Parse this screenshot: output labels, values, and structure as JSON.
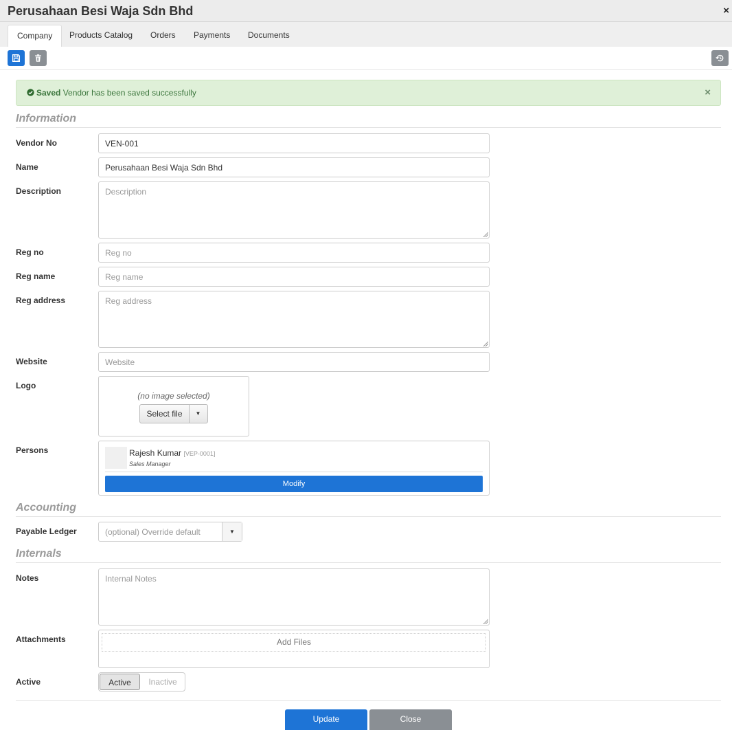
{
  "window": {
    "title": "Perusahaan Besi Waja Sdn Bhd",
    "close_glyph": "×"
  },
  "tabs": [
    {
      "label": "Company",
      "active": true
    },
    {
      "label": "Products Catalog"
    },
    {
      "label": "Orders"
    },
    {
      "label": "Payments"
    },
    {
      "label": "Documents"
    }
  ],
  "toolbar": {
    "save_icon": "save-icon",
    "delete_icon": "trash-icon",
    "history_icon": "history-icon"
  },
  "alert": {
    "strong": "Saved",
    "message": "Vendor has been saved successfully",
    "close_glyph": "×"
  },
  "sections": {
    "information": "Information",
    "accounting": "Accounting",
    "internals": "Internals"
  },
  "fields": {
    "vendor_no": {
      "label": "Vendor No",
      "value": "VEN-001"
    },
    "name": {
      "label": "Name",
      "value": "Perusahaan Besi Waja Sdn Bhd"
    },
    "description": {
      "label": "Description",
      "placeholder": "Description"
    },
    "reg_no": {
      "label": "Reg no",
      "placeholder": "Reg no"
    },
    "reg_name": {
      "label": "Reg name",
      "placeholder": "Reg name"
    },
    "reg_address": {
      "label": "Reg address",
      "placeholder": "Reg address"
    },
    "website": {
      "label": "Website",
      "placeholder": "Website"
    },
    "logo": {
      "label": "Logo",
      "no_image": "(no image selected)",
      "select_file": "Select file"
    },
    "persons": {
      "label": "Persons",
      "items": [
        {
          "name": "Rajesh Kumar",
          "code": "[VEP-0001]",
          "role": "Sales Manager"
        }
      ],
      "modify_label": "Modify"
    },
    "payable_ledger": {
      "label": "Payable Ledger",
      "placeholder": "(optional) Override default"
    },
    "notes": {
      "label": "Notes",
      "placeholder": "Internal Notes"
    },
    "attachments": {
      "label": "Attachments",
      "add_label": "Add Files"
    },
    "active": {
      "label": "Active",
      "on_label": "Active",
      "off_label": "Inactive",
      "selected": "Active"
    }
  },
  "footer": {
    "update_label": "Update",
    "close_label": "Close"
  },
  "colors": {
    "primary": "#1e74d6",
    "secondary": "#8a8f94",
    "success_bg": "#dff0d8",
    "success_text": "#3c763d"
  }
}
